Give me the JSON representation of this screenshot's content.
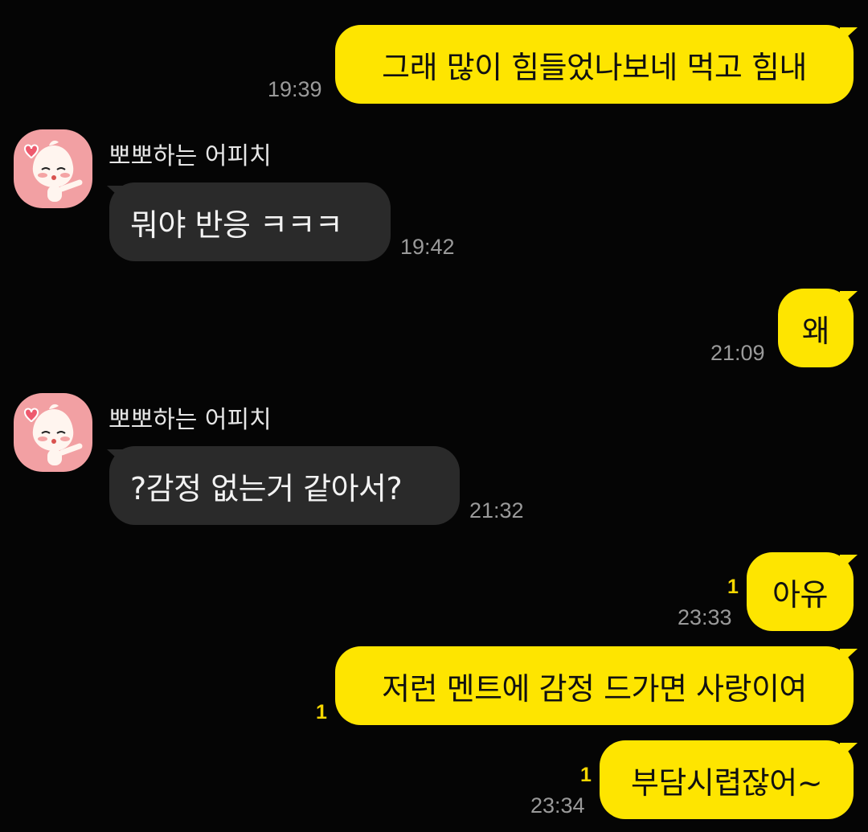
{
  "theme": {
    "background": "#050505",
    "my_bubble": "#fee500",
    "other_bubble": "#2a2a2a",
    "unread_color": "#f7d700",
    "avatar_bg": "#f2a0a3"
  },
  "messages": [
    {
      "from": "me",
      "text": "그래 많이 힘들었나보네 먹고 힘내",
      "time": "19:39"
    },
    {
      "from": "other",
      "sender": "뽀뽀하는 어피치",
      "avatar": "apeach-kiss-avatar",
      "text": "뭐야 반응 ㅋㅋㅋ",
      "time": "19:42"
    },
    {
      "from": "me",
      "text": "왜",
      "time": "21:09"
    },
    {
      "from": "other",
      "sender": "뽀뽀하는 어피치",
      "avatar": "apeach-kiss-avatar",
      "text": "?감정 없는거 같아서?",
      "time": "21:32"
    },
    {
      "from": "me",
      "text": "아유",
      "time": "23:33",
      "unread": "1"
    },
    {
      "from": "me",
      "text": "저런 멘트에 감정 드가면 사랑이여",
      "unread": "1"
    },
    {
      "from": "me",
      "text": "부담시렵잖어~",
      "time": "23:34",
      "unread": "1"
    }
  ]
}
